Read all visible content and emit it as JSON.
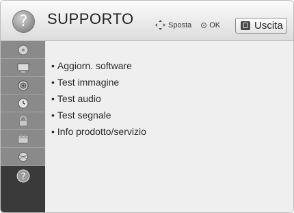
{
  "header": {
    "icon": "question-icon",
    "title": "SUPPORTO",
    "move_hint": "Sposta",
    "ok_hint": "OK",
    "exit_label": "Uscita"
  },
  "sidebar": {
    "items": [
      {
        "icon": "disc-icon"
      },
      {
        "icon": "screen-icon"
      },
      {
        "icon": "speaker-icon"
      },
      {
        "icon": "clock-icon"
      },
      {
        "icon": "lock-icon"
      },
      {
        "icon": "calendar-icon"
      },
      {
        "icon": "globe-icon"
      },
      {
        "icon": "question-icon",
        "active": true
      }
    ]
  },
  "menu": {
    "bullet": "•",
    "items": [
      "Aggiorn. software",
      "Test immagine",
      "Test audio",
      "Test segnale",
      "Info prodotto/servizio"
    ]
  },
  "colors": {
    "sidebar": "#8a8a8a",
    "sidebar_active": "#3a3a3a",
    "content_bg": "#efefef",
    "header_bg": "#e6e6e6"
  }
}
